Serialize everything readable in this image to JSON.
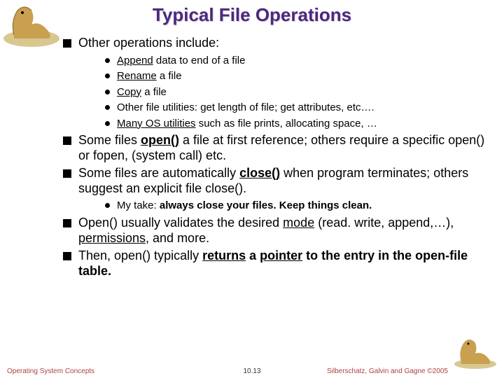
{
  "title": "Typical File Operations",
  "bullets": {
    "b1": "Other operations include:",
    "b1_1a": "Append",
    "b1_1b": " data to end of a file",
    "b1_2a": "Rename",
    "b1_2b": " a file",
    "b1_3a": "Copy",
    "b1_3b": " a file",
    "b1_4": "Other file utilities:  get length of file;  get attributes, etc….",
    "b1_5a": "Many OS utilities",
    "b1_5b": " such as file prints, allocating space, …",
    "b2a": " Some files ",
    "b2b": "open()",
    "b2c": " a file at first reference;  others require a specific open() or fopen, (system call) etc.",
    "b3a": "Some files are automatically ",
    "b3b": "close()",
    "b3c": " when program terminates;  others suggest an explicit file close().",
    "b3_1a": "My take:  ",
    "b3_1b": "always close your files.  Keep things clean.",
    "b4a": "Open() usually validates the desired ",
    "b4b": "mode",
    "b4c": " (read. write, append,…), ",
    "b4d": "permissions,",
    "b4e": " and more.",
    "b5a": "Then, open() typically ",
    "b5b": "returns",
    "b5c": " a ",
    "b5d": "pointer",
    "b5e": " to the entry in the open-file table."
  },
  "footer": {
    "left": "Operating System Concepts",
    "center": "10.13",
    "right": "Silberschatz, Galvin and Gagne ©2005"
  },
  "colors": {
    "title": "#4a2a7a",
    "footer_accent": "#b04040"
  }
}
